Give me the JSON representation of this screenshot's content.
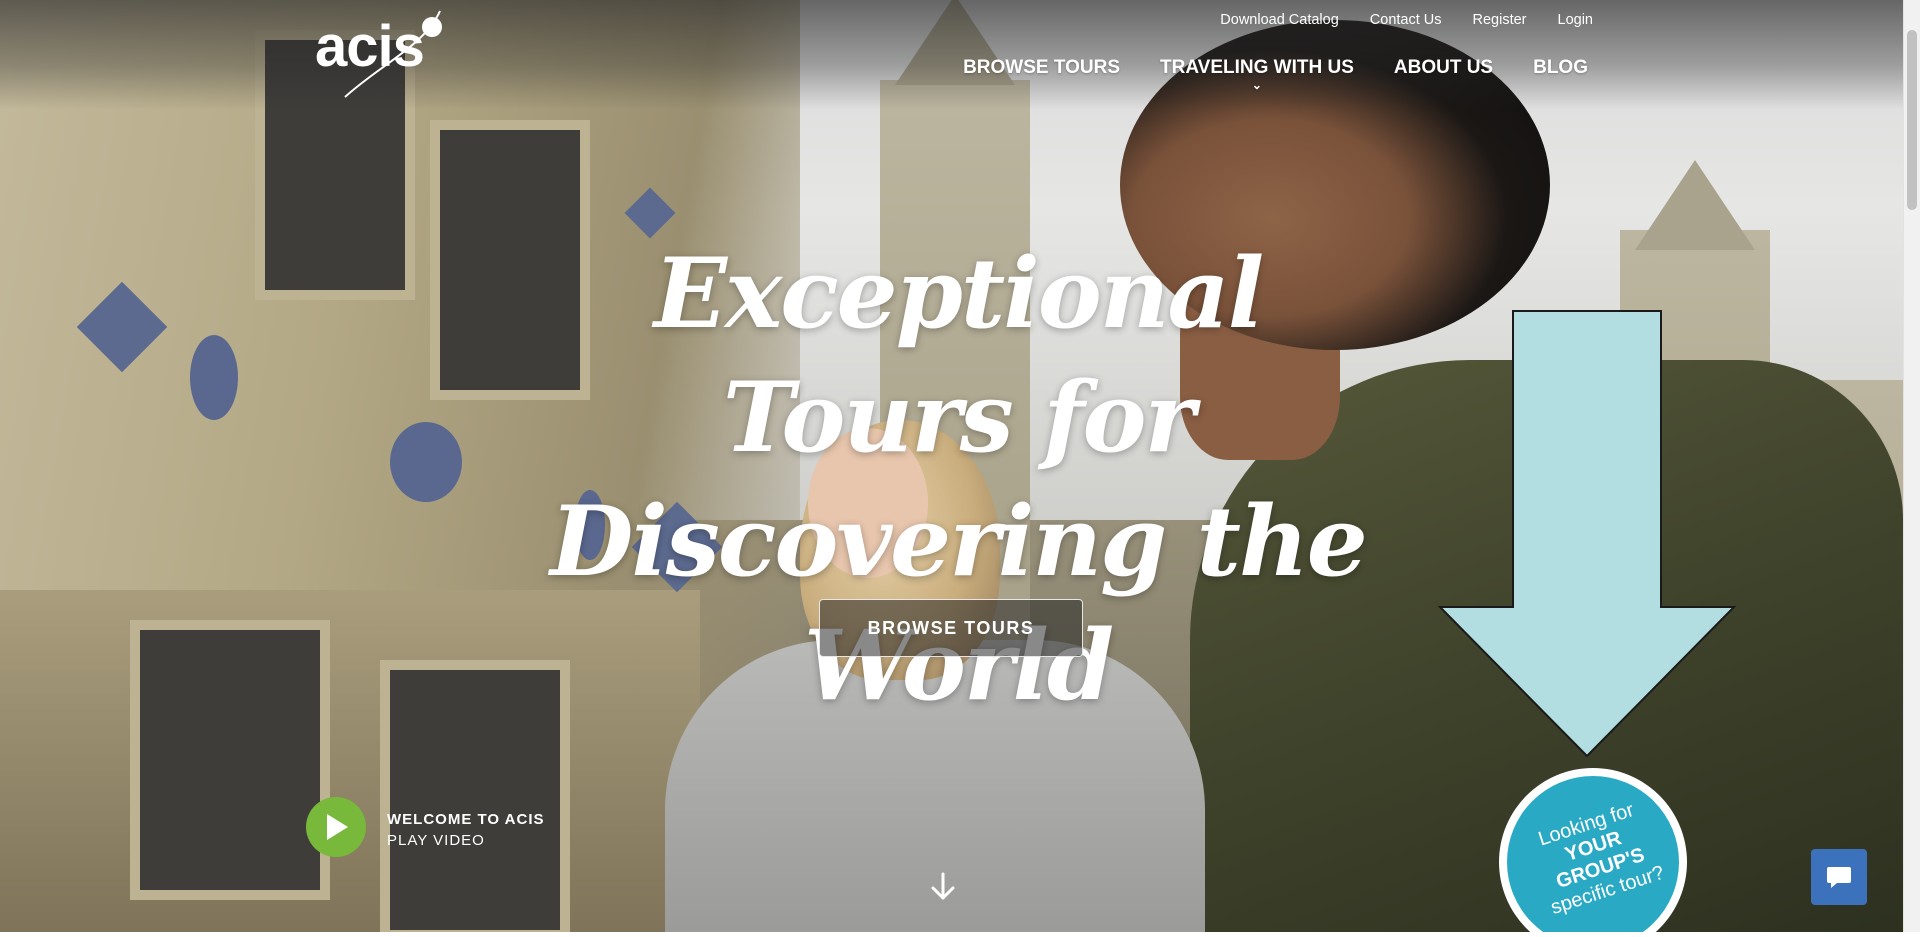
{
  "header": {
    "logo_text": "acis",
    "utility_nav": [
      "Download Catalog",
      "Contact Us",
      "Register",
      "Login"
    ],
    "main_nav": [
      {
        "label": "BROWSE TOURS",
        "has_dropdown": false
      },
      {
        "label": "TRAVELING WITH US",
        "has_dropdown": true
      },
      {
        "label": "ABOUT US",
        "has_dropdown": false
      },
      {
        "label": "BLOG",
        "has_dropdown": false
      }
    ]
  },
  "hero": {
    "headline_line1": "Exceptional Tours for",
    "headline_line2": "Discovering the World",
    "cta_label": "BROWSE TOURS"
  },
  "video": {
    "title": "WELCOME TO ACIS",
    "subtitle": "PLAY VIDEO"
  },
  "sticker": {
    "line1": "Looking for",
    "line2": "YOUR",
    "line3": "GROUP'S",
    "line4": "specific tour?"
  },
  "icons": {
    "play": "play-icon",
    "scroll_down": "arrow-down-icon",
    "chat": "chat-bubble-icon",
    "dropdown": "chevron-down-icon"
  },
  "colors": {
    "play_button": "#78b83a",
    "sticker": "#2aa9c4",
    "annotation_arrow": "#b2dde1",
    "chat_button": "#3c72bb"
  }
}
